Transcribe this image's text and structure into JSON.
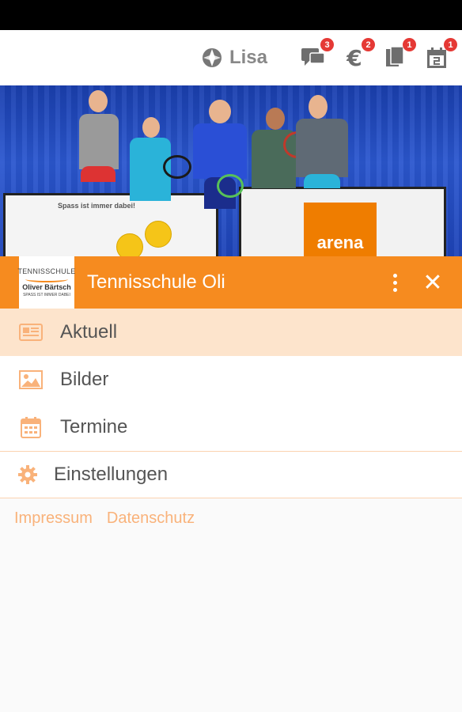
{
  "topbar": {
    "user_name": "Lisa",
    "icons": [
      {
        "name": "chat-icon",
        "badge": "3"
      },
      {
        "name": "euro-icon",
        "badge": "2"
      },
      {
        "name": "documents-icon",
        "badge": "1"
      },
      {
        "name": "calendar-icon",
        "badge": "1"
      }
    ]
  },
  "hero": {
    "banner_left_text": "Spass ist immer dabei!",
    "banner_right_text": "arena"
  },
  "drawer": {
    "logo_line1": "TENNISSCHULE",
    "logo_line2": "Oliver Bärtsch",
    "logo_line3": "SPASS IST IMMER DABEI",
    "title": "Tennisschule Oli",
    "accent_color": "#f68b1f"
  },
  "menu": {
    "items": [
      {
        "label": "Aktuell",
        "icon": "news-icon",
        "active": true
      },
      {
        "label": "Bilder",
        "icon": "image-icon",
        "active": false
      },
      {
        "label": "Termine",
        "icon": "calendar-icon",
        "active": false
      }
    ],
    "settings_label": "Einstellungen"
  },
  "footer": {
    "impressum": "Impressum",
    "datenschutz": "Datenschutz"
  }
}
